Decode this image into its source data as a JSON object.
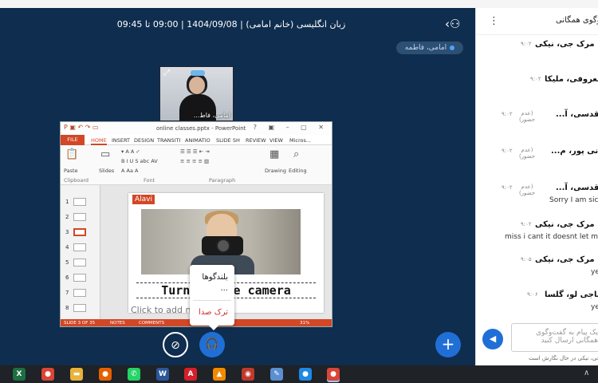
{
  "meeting": {
    "title": "زبان انگلیسی (خانم امامی) | 1404/09/08 | 09:00 تا 09:45",
    "presenter_chip": "امامی، فاطمه",
    "webcam_label": "امامی، فاط..."
  },
  "powerpoint": {
    "window_title": "online classes.pptx - PowerPoint",
    "tabs": [
      "FILE",
      "HOME",
      "INSERT",
      "DESIGN",
      "TRANSITI",
      "ANIMATIO",
      "SLIDE SH",
      "REVIEW",
      "VIEW",
      "Micros..."
    ],
    "ribbon": {
      "paste": "Paste",
      "slides": "Slides",
      "drawing": "Drawing",
      "editing": "Editing",
      "clipboard": "Clipboard",
      "font": "Font",
      "paragraph": "Paragraph"
    },
    "slide_numbers": [
      "1",
      "2",
      "3",
      "4",
      "5",
      "6",
      "7",
      "8"
    ],
    "slide": {
      "tag": "Alavi",
      "caption": "Turn on the camera",
      "notes_placeholder": "Click to add notes"
    },
    "status": {
      "slide_of": "SLIDE 3 OF 35",
      "notes": "NOTES",
      "comments": "COMMENTS",
      "zoom": "31%"
    }
  },
  "audio_menu": {
    "speakers": "بلندگوها",
    "more": "...",
    "leave_audio": "ترک صدا"
  },
  "chat": {
    "header": "گفت‌وگوی همگانی",
    "messages": [
      {
        "sender": "مرک جی، نیکی",
        "time": "۹:۰۲",
        "status": "",
        "text": ""
      },
      {
        "sender": "معروفی، ملیکا",
        "time": "۹:۰۲",
        "status": "",
        "text": ""
      },
      {
        "sender": "قدسی، آ...",
        "time": "۹:۰۲",
        "status": "(عدم حضور)",
        "text": ""
      },
      {
        "sender": "جانی پور، م...",
        "time": "۹:۰۲",
        "status": "(عدم حضور)",
        "text": ""
      },
      {
        "sender": "قدسی، آ...",
        "time": "۹:۰۲",
        "status": "(عدم حضور)",
        "text": "Sorry I am sick"
      },
      {
        "sender": "مرک جی، نیکی",
        "time": "۹:۰۲",
        "status": "",
        "text": "miss i cant it doesnt let me"
      },
      {
        "sender": "مرک جی، نیکی",
        "time": "۹:۰۵",
        "status": "",
        "text": "yes"
      },
      {
        "sender": "ناجی لو، گلسا",
        "time": "۹:۰۶",
        "status": "",
        "text": "yes"
      }
    ],
    "input_placeholder": "یک پیام به گفت‌وگوی همگانی ارسال کنید",
    "typing": "مرک جی، نیکی در حال نگارش است"
  },
  "taskbar": {
    "apps": [
      {
        "name": "excel",
        "glyph": "X",
        "color": "#1d6f42"
      },
      {
        "name": "chrome",
        "glyph": "●",
        "color": "#db4437"
      },
      {
        "name": "file-explorer",
        "glyph": "▬",
        "color": "#e8b33a"
      },
      {
        "name": "firefox",
        "glyph": "●",
        "color": "#e66000"
      },
      {
        "name": "whatsapp",
        "glyph": "✆",
        "color": "#25d366"
      },
      {
        "name": "word",
        "glyph": "W",
        "color": "#2b579a"
      },
      {
        "name": "acrobat",
        "glyph": "A",
        "color": "#d4202a"
      },
      {
        "name": "vlc",
        "glyph": "▲",
        "color": "#f28a00"
      },
      {
        "name": "media-player",
        "glyph": "◉",
        "color": "#c0392b"
      },
      {
        "name": "paint",
        "glyph": "✎",
        "color": "#5a8fd0"
      },
      {
        "name": "browser",
        "glyph": "●",
        "color": "#1e88e5"
      },
      {
        "name": "chrome-active",
        "glyph": "●",
        "color": "#db4437"
      }
    ]
  }
}
